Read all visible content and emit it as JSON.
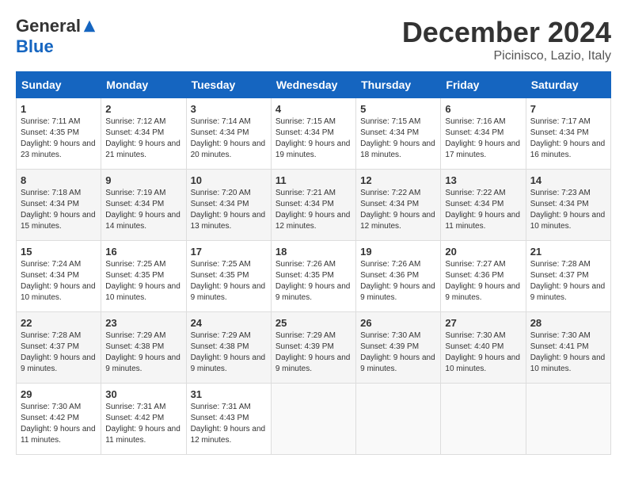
{
  "header": {
    "logo_general": "General",
    "logo_blue": "Blue",
    "month_title": "December 2024",
    "location": "Picinisco, Lazio, Italy"
  },
  "weekdays": [
    "Sunday",
    "Monday",
    "Tuesday",
    "Wednesday",
    "Thursday",
    "Friday",
    "Saturday"
  ],
  "weeks": [
    [
      {
        "day": "1",
        "sunrise": "7:11 AM",
        "sunset": "4:35 PM",
        "daylight": "9 hours and 23 minutes."
      },
      {
        "day": "2",
        "sunrise": "7:12 AM",
        "sunset": "4:34 PM",
        "daylight": "9 hours and 21 minutes."
      },
      {
        "day": "3",
        "sunrise": "7:14 AM",
        "sunset": "4:34 PM",
        "daylight": "9 hours and 20 minutes."
      },
      {
        "day": "4",
        "sunrise": "7:15 AM",
        "sunset": "4:34 PM",
        "daylight": "9 hours and 19 minutes."
      },
      {
        "day": "5",
        "sunrise": "7:15 AM",
        "sunset": "4:34 PM",
        "daylight": "9 hours and 18 minutes."
      },
      {
        "day": "6",
        "sunrise": "7:16 AM",
        "sunset": "4:34 PM",
        "daylight": "9 hours and 17 minutes."
      },
      {
        "day": "7",
        "sunrise": "7:17 AM",
        "sunset": "4:34 PM",
        "daylight": "9 hours and 16 minutes."
      }
    ],
    [
      {
        "day": "8",
        "sunrise": "7:18 AM",
        "sunset": "4:34 PM",
        "daylight": "9 hours and 15 minutes."
      },
      {
        "day": "9",
        "sunrise": "7:19 AM",
        "sunset": "4:34 PM",
        "daylight": "9 hours and 14 minutes."
      },
      {
        "day": "10",
        "sunrise": "7:20 AM",
        "sunset": "4:34 PM",
        "daylight": "9 hours and 13 minutes."
      },
      {
        "day": "11",
        "sunrise": "7:21 AM",
        "sunset": "4:34 PM",
        "daylight": "9 hours and 12 minutes."
      },
      {
        "day": "12",
        "sunrise": "7:22 AM",
        "sunset": "4:34 PM",
        "daylight": "9 hours and 12 minutes."
      },
      {
        "day": "13",
        "sunrise": "7:22 AM",
        "sunset": "4:34 PM",
        "daylight": "9 hours and 11 minutes."
      },
      {
        "day": "14",
        "sunrise": "7:23 AM",
        "sunset": "4:34 PM",
        "daylight": "9 hours and 10 minutes."
      }
    ],
    [
      {
        "day": "15",
        "sunrise": "7:24 AM",
        "sunset": "4:34 PM",
        "daylight": "9 hours and 10 minutes."
      },
      {
        "day": "16",
        "sunrise": "7:25 AM",
        "sunset": "4:35 PM",
        "daylight": "9 hours and 10 minutes."
      },
      {
        "day": "17",
        "sunrise": "7:25 AM",
        "sunset": "4:35 PM",
        "daylight": "9 hours and 9 minutes."
      },
      {
        "day": "18",
        "sunrise": "7:26 AM",
        "sunset": "4:35 PM",
        "daylight": "9 hours and 9 minutes."
      },
      {
        "day": "19",
        "sunrise": "7:26 AM",
        "sunset": "4:36 PM",
        "daylight": "9 hours and 9 minutes."
      },
      {
        "day": "20",
        "sunrise": "7:27 AM",
        "sunset": "4:36 PM",
        "daylight": "9 hours and 9 minutes."
      },
      {
        "day": "21",
        "sunrise": "7:28 AM",
        "sunset": "4:37 PM",
        "daylight": "9 hours and 9 minutes."
      }
    ],
    [
      {
        "day": "22",
        "sunrise": "7:28 AM",
        "sunset": "4:37 PM",
        "daylight": "9 hours and 9 minutes."
      },
      {
        "day": "23",
        "sunrise": "7:29 AM",
        "sunset": "4:38 PM",
        "daylight": "9 hours and 9 minutes."
      },
      {
        "day": "24",
        "sunrise": "7:29 AM",
        "sunset": "4:38 PM",
        "daylight": "9 hours and 9 minutes."
      },
      {
        "day": "25",
        "sunrise": "7:29 AM",
        "sunset": "4:39 PM",
        "daylight": "9 hours and 9 minutes."
      },
      {
        "day": "26",
        "sunrise": "7:30 AM",
        "sunset": "4:39 PM",
        "daylight": "9 hours and 9 minutes."
      },
      {
        "day": "27",
        "sunrise": "7:30 AM",
        "sunset": "4:40 PM",
        "daylight": "9 hours and 10 minutes."
      },
      {
        "day": "28",
        "sunrise": "7:30 AM",
        "sunset": "4:41 PM",
        "daylight": "9 hours and 10 minutes."
      }
    ],
    [
      {
        "day": "29",
        "sunrise": "7:30 AM",
        "sunset": "4:42 PM",
        "daylight": "9 hours and 11 minutes."
      },
      {
        "day": "30",
        "sunrise": "7:31 AM",
        "sunset": "4:42 PM",
        "daylight": "9 hours and 11 minutes."
      },
      {
        "day": "31",
        "sunrise": "7:31 AM",
        "sunset": "4:43 PM",
        "daylight": "9 hours and 12 minutes."
      },
      null,
      null,
      null,
      null
    ]
  ],
  "labels": {
    "sunrise": "Sunrise:",
    "sunset": "Sunset:",
    "daylight": "Daylight:"
  }
}
